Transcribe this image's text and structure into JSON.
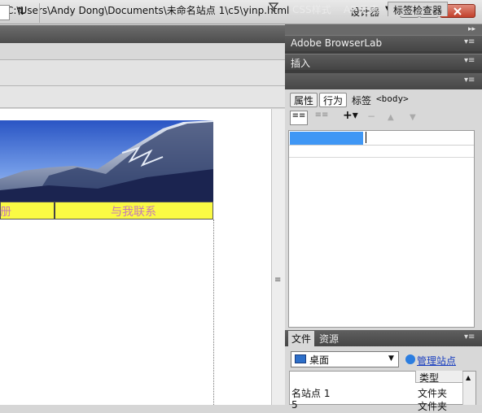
{
  "app_bar": {
    "workspace_label": "设计器"
  },
  "document": {
    "path": "C:\\Users\\Andy Dong\\Documents\\未命名站点 1\\c5\\yinp.html",
    "nav": {
      "left_text": "册",
      "right_text": "与我联系"
    }
  },
  "panels": {
    "browserlab": "Adobe BrowserLab",
    "insert": "插入",
    "tag_tabs": [
      "CSS样式",
      "AP 元素",
      "标签检查器"
    ],
    "tag_inspector": {
      "btn_attributes": "属性",
      "btn_behaviors": "行为",
      "label": "标签",
      "tag_name": "<body>"
    },
    "files": {
      "tabs": [
        "文件",
        "资源"
      ],
      "site_selected": "桌面",
      "manage_sites": "管理站点",
      "col_type": "类型",
      "rows": [
        {
          "name": "名站点 1",
          "type": "文件夹"
        },
        {
          "name": "5",
          "type": "文件夹"
        }
      ]
    }
  },
  "colors": {
    "nav_bg": "#fafa44",
    "nav_text": "#c57ab8",
    "selection": "#3f97f5"
  }
}
